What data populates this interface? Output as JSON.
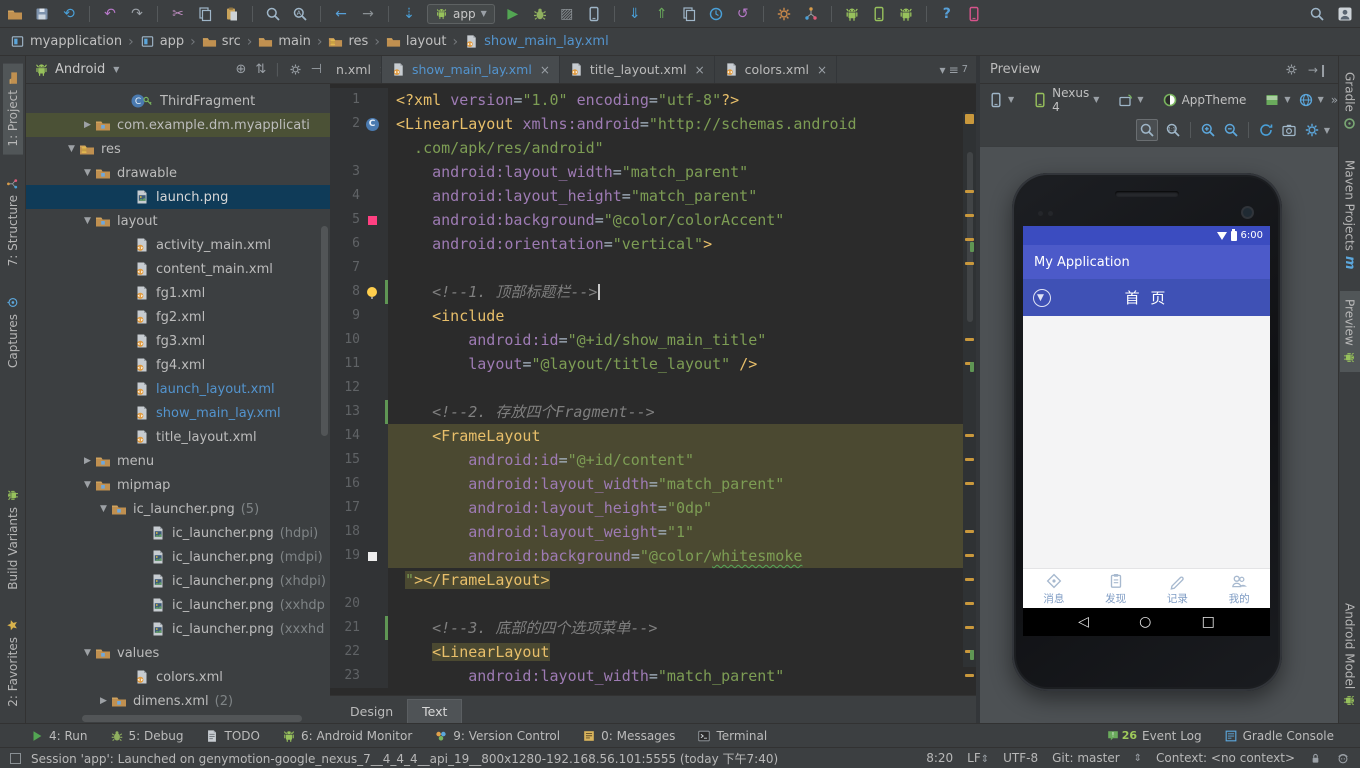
{
  "top_toolbar": {
    "run_config": "app",
    "icons": [
      {
        "n": "open-file",
        "t": "sprite",
        "s": "folder"
      },
      {
        "n": "save-all",
        "t": "sprite",
        "s": "floppy"
      },
      {
        "n": "synchronize",
        "t": "glyph",
        "g": "⟲",
        "c": "#4aa0d8"
      },
      {
        "t": "div"
      },
      {
        "n": "undo",
        "t": "glyph",
        "g": "↶",
        "c": "#b678c8"
      },
      {
        "n": "redo",
        "t": "glyph",
        "g": "↷",
        "c": "#9aa0a6"
      },
      {
        "t": "div"
      },
      {
        "n": "cut",
        "t": "glyph",
        "g": "✂",
        "c": "#bd8cbf"
      },
      {
        "n": "copy",
        "t": "sprite",
        "s": "copy2"
      },
      {
        "n": "paste",
        "t": "sprite",
        "s": "paste"
      },
      {
        "t": "div"
      },
      {
        "n": "find",
        "t": "sprite",
        "s": "magnifier",
        "c": "#9fb6c8"
      },
      {
        "n": "replace",
        "t": "sprite",
        "s": "mag-a",
        "c": "#9fb6c8"
      },
      {
        "t": "div"
      },
      {
        "n": "navigate-back",
        "t": "glyph",
        "g": "←",
        "c": "#57a0d8"
      },
      {
        "n": "navigate-forward",
        "t": "glyph",
        "g": "→",
        "c": "#8a9094"
      },
      {
        "t": "div"
      },
      {
        "n": "download-sources",
        "t": "glyph",
        "g": "⇣",
        "c": "#4aa0d8"
      },
      {
        "t": "combo"
      },
      {
        "n": "run",
        "t": "glyph",
        "g": "▶",
        "c": "#53a653"
      },
      {
        "n": "debug",
        "t": "sprite",
        "s": "bug"
      },
      {
        "n": "run-with-coverage",
        "t": "glyph",
        "g": "▨",
        "c": "#8a9094"
      },
      {
        "n": "attach-debugger-to-android-process",
        "t": "sprite",
        "s": "phone",
        "c": "#9fb6c8"
      },
      {
        "t": "div"
      },
      {
        "n": "vcs-update-project",
        "t": "glyph",
        "g": "⇓",
        "c": "#4aa0d8"
      },
      {
        "n": "vcs-commit-changes",
        "t": "glyph",
        "g": "⇑",
        "c": "#6aab5c"
      },
      {
        "n": "vcs-compare",
        "t": "sprite",
        "s": "copy2"
      },
      {
        "n": "recent-changes",
        "t": "sprite",
        "s": "clock",
        "c": "#4aa0d8"
      },
      {
        "n": "rollback",
        "t": "glyph",
        "g": "↺",
        "c": "#b678c8"
      },
      {
        "t": "div"
      },
      {
        "n": "settings",
        "t": "sprite",
        "s": "gear",
        "c": "#c98a4b"
      },
      {
        "n": "project-structure",
        "t": "sprite",
        "s": "structure"
      },
      {
        "t": "div"
      },
      {
        "n": "sdk-manager",
        "t": "sprite",
        "s": "android"
      },
      {
        "n": "avd-manager",
        "t": "sprite",
        "s": "phone",
        "c": "#97c15c"
      },
      {
        "n": "android-device-monitor",
        "t": "sprite",
        "s": "android"
      },
      {
        "t": "div"
      },
      {
        "n": "help",
        "t": "glyph",
        "g": "?",
        "c": "#57a0d8"
      },
      {
        "n": "genymotion",
        "t": "sprite",
        "s": "phone",
        "c": "#d8548c"
      }
    ],
    "right_icons": [
      {
        "n": "search-everywhere",
        "t": "sprite",
        "s": "magnifier",
        "c": "#9fb6c8"
      },
      {
        "n": "user-avatar",
        "t": "sprite",
        "s": "avatar"
      }
    ]
  },
  "breadcrumbs": [
    {
      "label": "myapplication",
      "icon": "project"
    },
    {
      "label": "app",
      "icon": "project"
    },
    {
      "label": "src",
      "icon": "folder"
    },
    {
      "label": "main",
      "icon": "folder"
    },
    {
      "label": "res",
      "icon": "res"
    },
    {
      "label": "layout",
      "icon": "folder"
    },
    {
      "label": "show_main_lay.xml",
      "icon": "xml",
      "active": true
    }
  ],
  "left_stripe": {
    "top": [
      {
        "label": "1: Project",
        "icon": "folder",
        "active": true
      },
      {
        "label": "7: Structure",
        "icon": "structure"
      },
      {
        "label": "Captures",
        "icon": "capture"
      }
    ],
    "bottom": [
      {
        "label": "Build Variants",
        "icon": "android"
      },
      {
        "label": "2: Favorites",
        "icon": "star"
      }
    ]
  },
  "right_stripe": {
    "top": [
      {
        "label": "Gradle",
        "icon": "gradle"
      },
      {
        "label": "Maven Projects",
        "icon": "maven"
      },
      {
        "label": "Preview",
        "icon": "android",
        "active": true
      }
    ],
    "bottom": [
      {
        "label": "Android Model",
        "icon": "android"
      }
    ]
  },
  "project_panel": {
    "view": "Android",
    "tree": [
      {
        "pad": 104,
        "icon": "class",
        "key": true,
        "label": "ThirdFragment"
      },
      {
        "pad": 56,
        "arrow": "r",
        "icon": "folder-dot",
        "label": "com.example.dm.myapplicati",
        "hl": "olive"
      },
      {
        "pad": 40,
        "arrow": "d",
        "icon": "res",
        "label": "res"
      },
      {
        "pad": 56,
        "arrow": "d",
        "icon": "folder-dot",
        "label": "drawable"
      },
      {
        "pad": 108,
        "icon": "img",
        "label": "launch.png",
        "sel": true
      },
      {
        "pad": 56,
        "arrow": "d",
        "icon": "folder-dot",
        "label": "layout"
      },
      {
        "pad": 108,
        "icon": "xml",
        "label": "activity_main.xml"
      },
      {
        "pad": 108,
        "icon": "xml",
        "label": "content_main.xml"
      },
      {
        "pad": 108,
        "icon": "xml",
        "label": "fg1.xml"
      },
      {
        "pad": 108,
        "icon": "xml",
        "label": "fg2.xml"
      },
      {
        "pad": 108,
        "icon": "xml",
        "label": "fg3.xml"
      },
      {
        "pad": 108,
        "icon": "xml",
        "label": "fg4.xml"
      },
      {
        "pad": 108,
        "icon": "xml",
        "label": "launch_layout.xml",
        "blue": true
      },
      {
        "pad": 108,
        "icon": "xml",
        "label": "show_main_lay.xml",
        "blue": true
      },
      {
        "pad": 108,
        "icon": "xml",
        "label": "title_layout.xml"
      },
      {
        "pad": 56,
        "arrow": "r",
        "icon": "folder-dot",
        "label": "menu"
      },
      {
        "pad": 56,
        "arrow": "d",
        "icon": "folder-dot",
        "label": "mipmap"
      },
      {
        "pad": 72,
        "arrow": "d",
        "icon": "folder-dot",
        "label": "ic_launcher.png",
        "extra": "(5)"
      },
      {
        "pad": 124,
        "icon": "img",
        "label": "ic_launcher.png",
        "extra": "(hdpi)"
      },
      {
        "pad": 124,
        "icon": "img",
        "label": "ic_launcher.png",
        "extra": "(mdpi)"
      },
      {
        "pad": 124,
        "icon": "img",
        "label": "ic_launcher.png",
        "extra": "(xhdpi)"
      },
      {
        "pad": 124,
        "icon": "img",
        "label": "ic_launcher.png",
        "extra": "(xxhdp"
      },
      {
        "pad": 124,
        "icon": "img",
        "label": "ic_launcher.png",
        "extra": "(xxxhd"
      },
      {
        "pad": 56,
        "arrow": "d",
        "icon": "folder-dot",
        "label": "values"
      },
      {
        "pad": 108,
        "icon": "xml",
        "label": "colors.xml"
      },
      {
        "pad": 72,
        "arrow": "r",
        "icon": "folder-dot",
        "label": "dimens.xml",
        "extra": "(2)"
      }
    ]
  },
  "editor": {
    "tabs": [
      {
        "label": "n.xml",
        "partial": true
      },
      {
        "label": "show_main_lay.xml",
        "active": true
      },
      {
        "label": "title_layout.xml"
      },
      {
        "label": "colors.xml"
      }
    ],
    "tab_count": "7",
    "bottom_tabs": [
      {
        "label": "Design"
      },
      {
        "label": "Text",
        "active": true
      }
    ],
    "lines": [
      {
        "n": "1",
        "segs": [
          [
            "t",
            "<?xml "
          ],
          [
            "a",
            "version"
          ],
          [
            "p",
            "="
          ],
          [
            "v",
            "\"1.0\""
          ],
          [
            "p",
            " "
          ],
          [
            "a",
            "encoding"
          ],
          [
            "p",
            "="
          ],
          [
            "v",
            "\"utf-8\""
          ],
          [
            "t",
            "?>"
          ]
        ]
      },
      {
        "n": "2",
        "gut": "class",
        "segs": [
          [
            "t",
            "<LinearLayout "
          ],
          [
            "a",
            "xmlns:android"
          ],
          [
            "p",
            "="
          ],
          [
            "v",
            "\"http://schemas.android"
          ]
        ]
      },
      {
        "n": "",
        "segs": [
          [
            "v",
            "  .com/apk/res/android\""
          ]
        ]
      },
      {
        "n": "3",
        "segs": [
          [
            "p",
            "    "
          ],
          [
            "a",
            "android:layout_width"
          ],
          [
            "p",
            "="
          ],
          [
            "v",
            "\"match_parent\""
          ]
        ]
      },
      {
        "n": "4",
        "segs": [
          [
            "p",
            "    "
          ],
          [
            "a",
            "android:layout_height"
          ],
          [
            "p",
            "="
          ],
          [
            "v",
            "\"match_parent\""
          ]
        ]
      },
      {
        "n": "5",
        "gut": "pink",
        "segs": [
          [
            "p",
            "    "
          ],
          [
            "a",
            "android:background"
          ],
          [
            "p",
            "="
          ],
          [
            "v",
            "\"@color/colorAccent\""
          ]
        ]
      },
      {
        "n": "6",
        "segs": [
          [
            "p",
            "    "
          ],
          [
            "a",
            "android:orientation"
          ],
          [
            "p",
            "="
          ],
          [
            "v",
            "\"vertical\""
          ],
          [
            "t",
            ">"
          ]
        ]
      },
      {
        "n": "7",
        "segs": []
      },
      {
        "n": "8",
        "gut": "bulb",
        "bar": true,
        "caret": true,
        "segs": [
          [
            "p",
            "    "
          ],
          [
            "c",
            "<!--1. 顶部标题栏-->"
          ]
        ]
      },
      {
        "n": "9",
        "segs": [
          [
            "p",
            "    "
          ],
          [
            "t",
            "<include"
          ]
        ]
      },
      {
        "n": "10",
        "segs": [
          [
            "p",
            "        "
          ],
          [
            "a",
            "android:id"
          ],
          [
            "p",
            "="
          ],
          [
            "v",
            "\"@+id/show_main_title\""
          ]
        ]
      },
      {
        "n": "11",
        "segs": [
          [
            "p",
            "        "
          ],
          [
            "a",
            "layout"
          ],
          [
            "p",
            "="
          ],
          [
            "v",
            "\"@layout/title_layout\""
          ],
          [
            "p",
            " "
          ],
          [
            "t",
            "/>"
          ]
        ]
      },
      {
        "n": "12",
        "segs": []
      },
      {
        "n": "13",
        "bar": true,
        "segs": [
          [
            "p",
            "    "
          ],
          [
            "c",
            "<!--2. 存放四个Fragment-->"
          ]
        ]
      },
      {
        "n": "14",
        "hl": "full",
        "segs": [
          [
            "p",
            "    "
          ],
          [
            "t",
            "<FrameLayout"
          ]
        ]
      },
      {
        "n": "15",
        "hl": "full",
        "segs": [
          [
            "p",
            "        "
          ],
          [
            "a",
            "android:id"
          ],
          [
            "p",
            "="
          ],
          [
            "v",
            "\"@+id/content\""
          ]
        ]
      },
      {
        "n": "16",
        "hl": "full",
        "segs": [
          [
            "p",
            "        "
          ],
          [
            "a",
            "android:layout_width"
          ],
          [
            "p",
            "="
          ],
          [
            "v",
            "\"match_parent\""
          ]
        ]
      },
      {
        "n": "17",
        "hl": "full",
        "segs": [
          [
            "p",
            "        "
          ],
          [
            "a",
            "android:layout_height"
          ],
          [
            "p",
            "="
          ],
          [
            "v",
            "\"0dp\""
          ]
        ]
      },
      {
        "n": "18",
        "hl": "full",
        "segs": [
          [
            "p",
            "        "
          ],
          [
            "a",
            "android:layout_weight"
          ],
          [
            "p",
            "="
          ],
          [
            "v",
            "\"1\""
          ]
        ]
      },
      {
        "n": "19",
        "gut": "white",
        "hl": "full",
        "segs": [
          [
            "p",
            "        "
          ],
          [
            "a",
            "android:background"
          ],
          [
            "p",
            "="
          ],
          [
            "v",
            "\"@color/"
          ],
          [
            "w",
            "whitesmoke"
          ]
        ]
      },
      {
        "n": "",
        "hl": "text",
        "segs": [
          [
            "p",
            " "
          ],
          [
            "v",
            "\""
          ],
          [
            "t",
            "></FrameLayout>"
          ]
        ]
      },
      {
        "n": "20",
        "segs": []
      },
      {
        "n": "21",
        "bar": true,
        "segs": [
          [
            "p",
            "    "
          ],
          [
            "c",
            "<!--3. 底部的四个选项菜单-->"
          ]
        ]
      },
      {
        "n": "22",
        "hl": "text",
        "segs": [
          [
            "p",
            "    "
          ],
          [
            "t",
            "<LinearLayout"
          ]
        ]
      },
      {
        "n": "23",
        "segs": [
          [
            "p",
            "        "
          ],
          [
            "a",
            "android:layout_width"
          ],
          [
            "p",
            "="
          ],
          [
            "v",
            "\"match_parent\""
          ]
        ]
      }
    ]
  },
  "preview": {
    "title": "Preview",
    "device": "Nexus 4",
    "theme": "AppTheme",
    "overflow": "»",
    "phone": {
      "status_time": "6:00",
      "app_title": "My Application",
      "page_title": "首 页",
      "bottom_tabs": [
        {
          "label": "消息",
          "icon": "compass"
        },
        {
          "label": "发现",
          "icon": "discover"
        },
        {
          "label": "记录",
          "icon": "record"
        },
        {
          "label": "我的",
          "icon": "me"
        }
      ],
      "nav": [
        "◁",
        "○",
        "□"
      ]
    }
  },
  "bottom_toolbar": {
    "left": [
      {
        "label": "4: Run",
        "icon": "runs"
      },
      {
        "label": "5: Debug",
        "icon": "bug"
      },
      {
        "label": "TODO",
        "icon": "todo"
      },
      {
        "label": "6: Android Monitor",
        "icon": "android"
      },
      {
        "label": "9: Version Control",
        "icon": "vcs9"
      },
      {
        "label": "0: Messages",
        "icon": "messages"
      },
      {
        "label": "Terminal",
        "icon": "terminal"
      }
    ],
    "right": [
      {
        "label": "Event Log",
        "icon": "balloon",
        "count": "26"
      },
      {
        "label": "Gradle Console",
        "icon": "console"
      }
    ]
  },
  "status_bar": {
    "message": "Session 'app': Launched on genymotion-google_nexus_7__4_4_4__api_19__800x1280-192.168.56.101:5555 (today 下午7:40)",
    "position": "8:20",
    "line_separator": "LF",
    "encoding": "UTF-8",
    "git": "Git: master",
    "context": "Context: <no context>"
  }
}
